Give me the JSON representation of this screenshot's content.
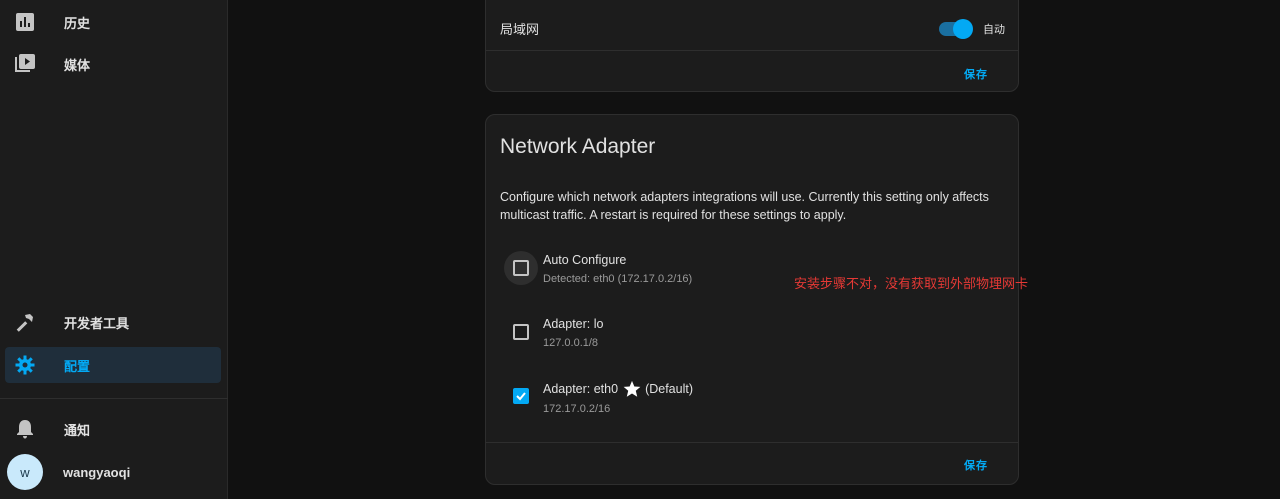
{
  "sidebar": {
    "items": [
      {
        "label": "历史",
        "icon": "chart-box-icon"
      },
      {
        "label": "媒体",
        "icon": "play-box-multiple-icon"
      },
      {
        "label": "开发者工具",
        "icon": "hammer-icon"
      },
      {
        "label": "配置",
        "icon": "gear-icon",
        "active": true
      }
    ],
    "notifications_label": "通知",
    "user": {
      "initial": "w",
      "name": "wangyaoqi"
    }
  },
  "lan_card": {
    "label": "局域网",
    "toggle_label": "自动",
    "toggle_on": true,
    "save_label": "保存"
  },
  "network_card": {
    "title": "Network Adapter",
    "description": "Configure which network adapters integrations will use. Currently this setting only affects multicast traffic. A restart is required for these settings to apply.",
    "adapters": [
      {
        "name": "Auto Configure",
        "detail": "Detected: eth0 (172.17.0.2/16)",
        "checked": false
      },
      {
        "name": "Adapter: lo",
        "detail": "127.0.0.1/8",
        "checked": false
      },
      {
        "name": "Adapter: eth0",
        "default_label": "(Default)",
        "detail": "172.17.0.2/16",
        "checked": true
      }
    ],
    "save_label": "保存"
  },
  "annotation": "安装步骤不对，没有获取到外部物理网卡",
  "colors": {
    "accent": "#03a9f4",
    "annotation": "#e53935"
  }
}
